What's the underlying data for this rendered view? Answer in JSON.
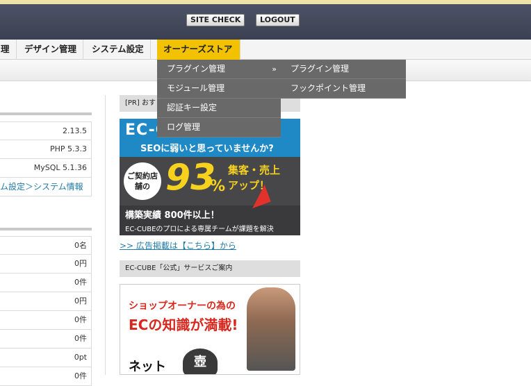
{
  "header": {
    "site_check": "SITE CHECK",
    "logout": "LOGOUT"
  },
  "nav": {
    "items": [
      "理",
      "デザイン管理",
      "システム設定",
      "オーナーズストア"
    ],
    "active": "オーナーズストア"
  },
  "dropdown": {
    "items": [
      "プラグイン管理",
      "モジュール管理",
      "認証キー設定",
      "ログ管理"
    ],
    "chevron": "»",
    "flyout": [
      "プラグイン管理",
      "フックポイント管理"
    ]
  },
  "system_info": {
    "rows": [
      "2.13.5",
      "PHP 5.3.3",
      "MySQL 5.1.36"
    ],
    "link": "ム設定＞システム情報"
  },
  "stats": {
    "rows": [
      "0名",
      "0円",
      "0件",
      "0円",
      "0件",
      "0件",
      "0pt",
      "0件"
    ]
  },
  "sidebar": {
    "pr_head": "[PR] おす",
    "banner1": {
      "title": "EC-CUBE",
      "seo": "SEOに弱いと思っていませんか?",
      "contract": "ご契約店舗の",
      "figure": "93",
      "percent": "%",
      "gain1": "集客・売上",
      "gain2": "アップ！",
      "record": "構築実績 800件以上！",
      "team": "EC-CUBEのプロによる専属チームが課題を解決"
    },
    "ad_link": ">> 広告掲載は【こちら】から",
    "service_head": "EC-CUBE「公式」サービスご案内",
    "banner2": {
      "line1": "ショップオーナーの為の",
      "line2": "ECの知識が満載!",
      "net": "ネット",
      "pot": "壺"
    }
  }
}
